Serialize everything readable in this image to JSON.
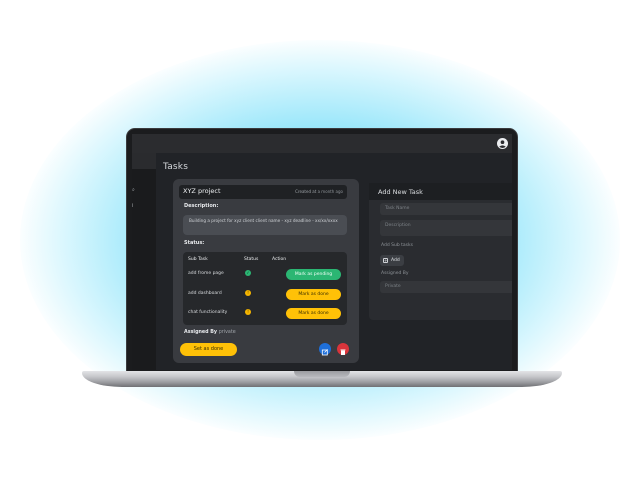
{
  "page": {
    "title": "Tasks"
  },
  "sidebar": {
    "marks": [
      "⌕",
      "ⅰ"
    ]
  },
  "task_card": {
    "title": "XYZ project",
    "created_label": "Created at",
    "created_value": "a month ago",
    "description_label": "Description:",
    "description": "Building a project for xyz client client name - xyz deadline - xx/xx/xxxx",
    "status_label": "Status:",
    "columns": [
      "Sub Task",
      "Status",
      "Action"
    ],
    "rows": [
      {
        "name": "add frome page",
        "status": "done",
        "action": "Mark as pending"
      },
      {
        "name": "add dashboard",
        "status": "pending",
        "action": "Mark as done"
      },
      {
        "name": "chat functionality",
        "status": "pending",
        "action": "Mark as done"
      }
    ],
    "assigned_label": "Assigned By",
    "assigned_value": "private",
    "set_done_label": "Set as done"
  },
  "new_task_panel": {
    "title": "Add New Task",
    "title_placeholder": "Task Name",
    "description_placeholder": "Description",
    "subtasks_label": "Add Sub tasks",
    "add_label": "Add",
    "assigned_label": "Assigned By",
    "assigned_value": "Private"
  },
  "colors": {
    "accent_green": "#2bb673",
    "accent_yellow": "#ffc107",
    "edit_blue": "#1e6fd9",
    "delete_red": "#d9343b",
    "glow": "#50d2f5"
  },
  "icons": [
    "user-icon",
    "kebab-icon",
    "check-icon",
    "pending-icon",
    "edit-icon",
    "trash-icon",
    "add-icon"
  ]
}
